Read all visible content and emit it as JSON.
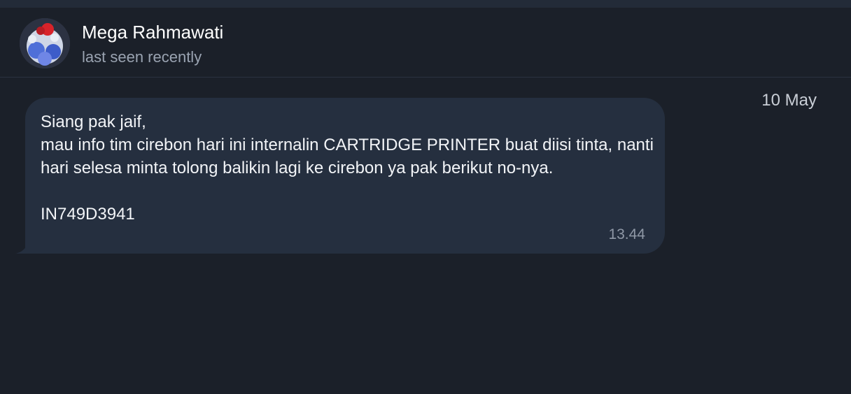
{
  "header": {
    "contact_name": "Mega Rahmawati",
    "status": "last seen recently",
    "avatar_icon": "contact-avatar"
  },
  "chat": {
    "date": "10 May",
    "messages": [
      {
        "text": "Siang pak jaif,\nmau info tim cirebon hari ini internalin CARTRIDGE  PRINTER buat diisi tinta, nanti hari selesa minta tolong balikin lagi ke cirebon ya pak berikut no-nya.\n\nIN749D3941",
        "time": "13.44"
      }
    ]
  },
  "colors": {
    "background": "#1b2029",
    "bubble": "#252f3f",
    "text": "#f2f4f7",
    "muted": "#9aa3b1"
  }
}
